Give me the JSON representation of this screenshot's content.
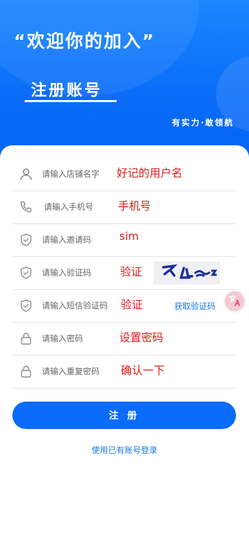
{
  "header": {
    "slogan": "“欢迎你的加入”",
    "title": "注册账号",
    "tagline": "有实力·敢领航"
  },
  "form": {
    "fields": [
      {
        "icon": "user-icon",
        "placeholder": "请输入店铺名字",
        "value": "好记的用户名"
      },
      {
        "icon": "phone-icon",
        "placeholder": "请输入手机号",
        "value": "手机号"
      },
      {
        "icon": "shield-icon",
        "placeholder": "请输入邀请码",
        "value": "sim"
      },
      {
        "icon": "shield-icon",
        "placeholder": "请输入验证码",
        "value": "验证"
      },
      {
        "icon": "shield-icon",
        "placeholder": "请输入短信验证码",
        "value": "验证"
      },
      {
        "icon": "lock-icon",
        "placeholder": "请输入密码",
        "value": "设置密码"
      },
      {
        "icon": "lock-icon",
        "placeholder": "请输入重复密码",
        "value": "确认一下"
      }
    ],
    "sms_button": "获取验证码",
    "submit_label": "注 册",
    "login_link": "使用已有账号登录"
  },
  "colors": {
    "primary": "#0a6cf8",
    "link": "#1677e8",
    "entered_text": "#e01b1b"
  }
}
